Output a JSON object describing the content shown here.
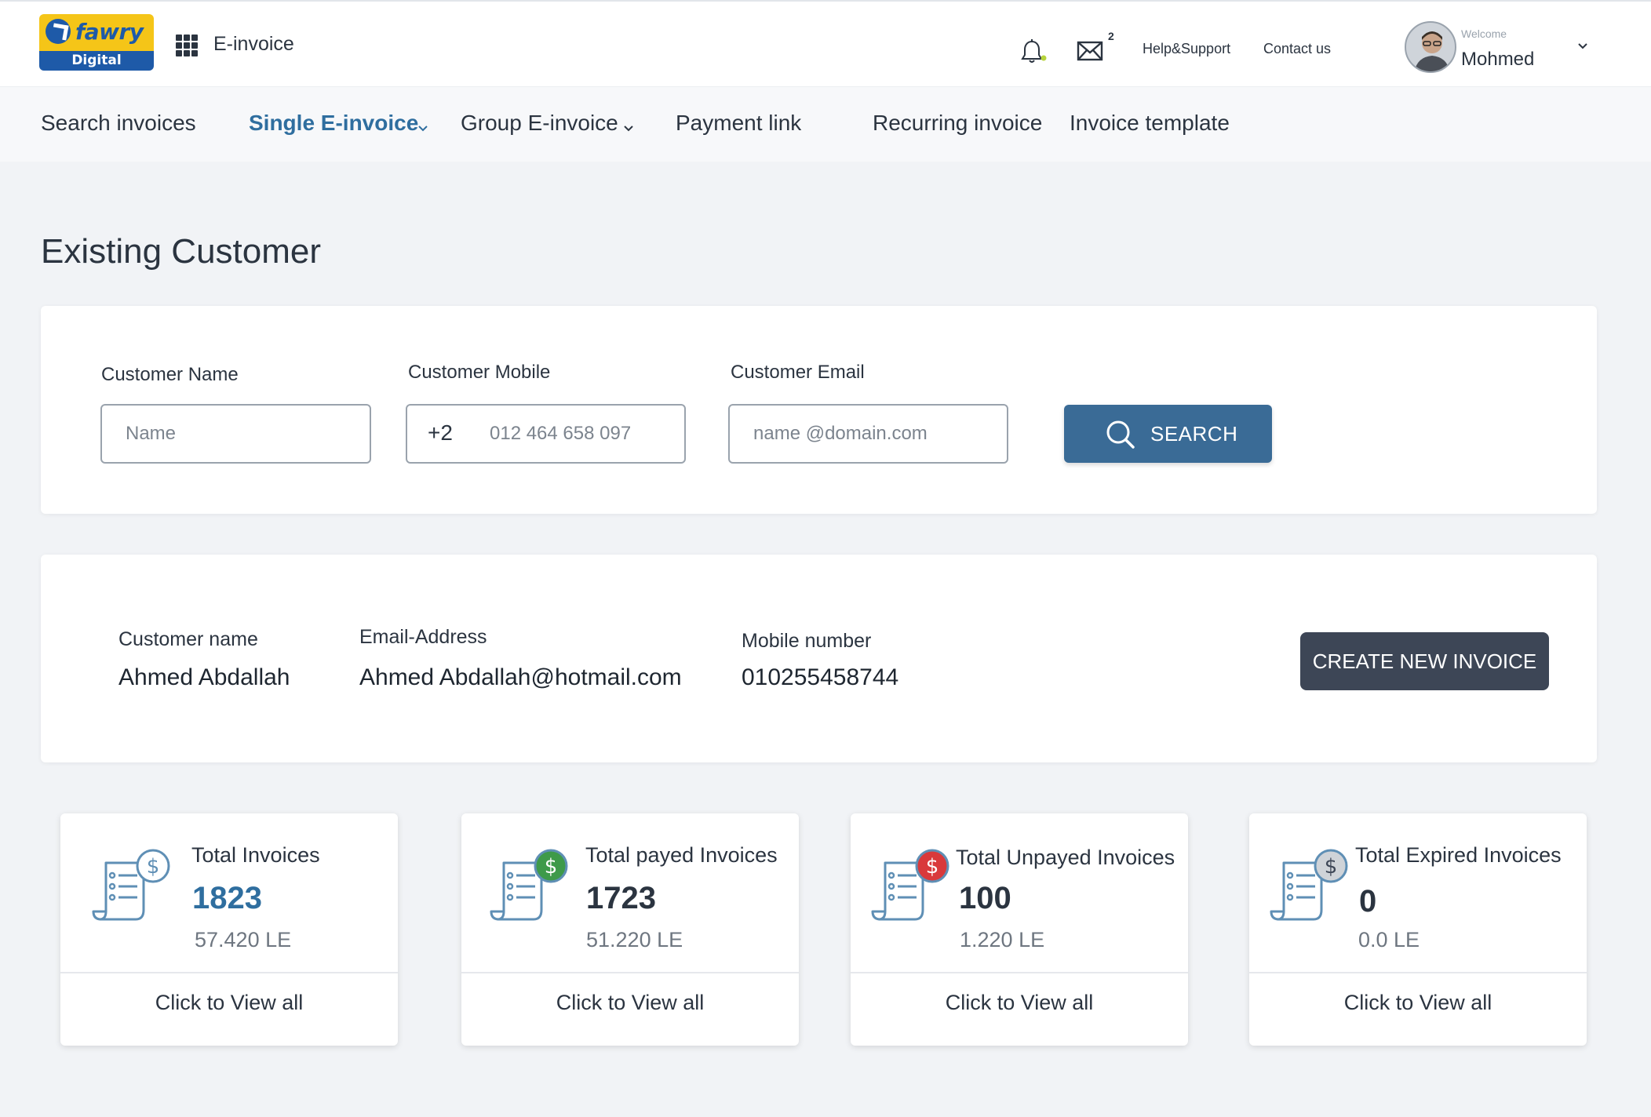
{
  "header": {
    "logo_word": "fawry",
    "logo_sub": "Digital",
    "app_title": "E-invoice",
    "mail_count": "2",
    "help_label": "Help&Support",
    "contact_label": "Contact us",
    "welcome_label": "Welcome",
    "user_name": "Mohmed"
  },
  "nav": {
    "items": [
      {
        "label": "Search invoices"
      },
      {
        "label": "Single E-invoice"
      },
      {
        "label": "Group E-invoice"
      },
      {
        "label": "Payment link"
      },
      {
        "label": "Recurring invoice"
      },
      {
        "label": "Invoice template"
      }
    ]
  },
  "page": {
    "title": "Existing Customer"
  },
  "search": {
    "name_label": "Customer Name",
    "name_placeholder": "Name",
    "mobile_label": "Customer Mobile",
    "mobile_prefix": "+2",
    "mobile_placeholder": "012 464 658 097",
    "email_label": "Customer Email",
    "email_placeholder": "name @domain.com",
    "button_label": "SEARCH"
  },
  "customer": {
    "name_label": "Customer name",
    "name_value": "Ahmed Abdallah",
    "email_label": "Email-Address",
    "email_value": "Ahmed Abdallah@hotmail.com",
    "mobile_label": "Mobile number",
    "mobile_value": "010255458744",
    "create_label": "CREATE NEW INVOICE"
  },
  "stats": [
    {
      "title": "Total Invoices",
      "count": "1823",
      "amount": "57.420 LE",
      "link": "Click to View all",
      "badge_color": "#ffffff"
    },
    {
      "title": "Total payed Invoices",
      "count": "1723",
      "amount": "51.220 LE",
      "link": "Click to View all",
      "badge_color": "#3e9a4a"
    },
    {
      "title": "Total Unpayed Invoices",
      "count": "100",
      "amount": "1.220 LE",
      "link": "Click to View all",
      "badge_color": "#d9393b"
    },
    {
      "title": "Total Expired  Invoices",
      "count": "0",
      "amount": "0.0 LE",
      "link": "Click to View all",
      "badge_color": "#cfd3d8"
    }
  ],
  "colors": {
    "accent": "#2f6e9f",
    "search_button": "#3a6b96",
    "create_button": "#3d4656"
  }
}
